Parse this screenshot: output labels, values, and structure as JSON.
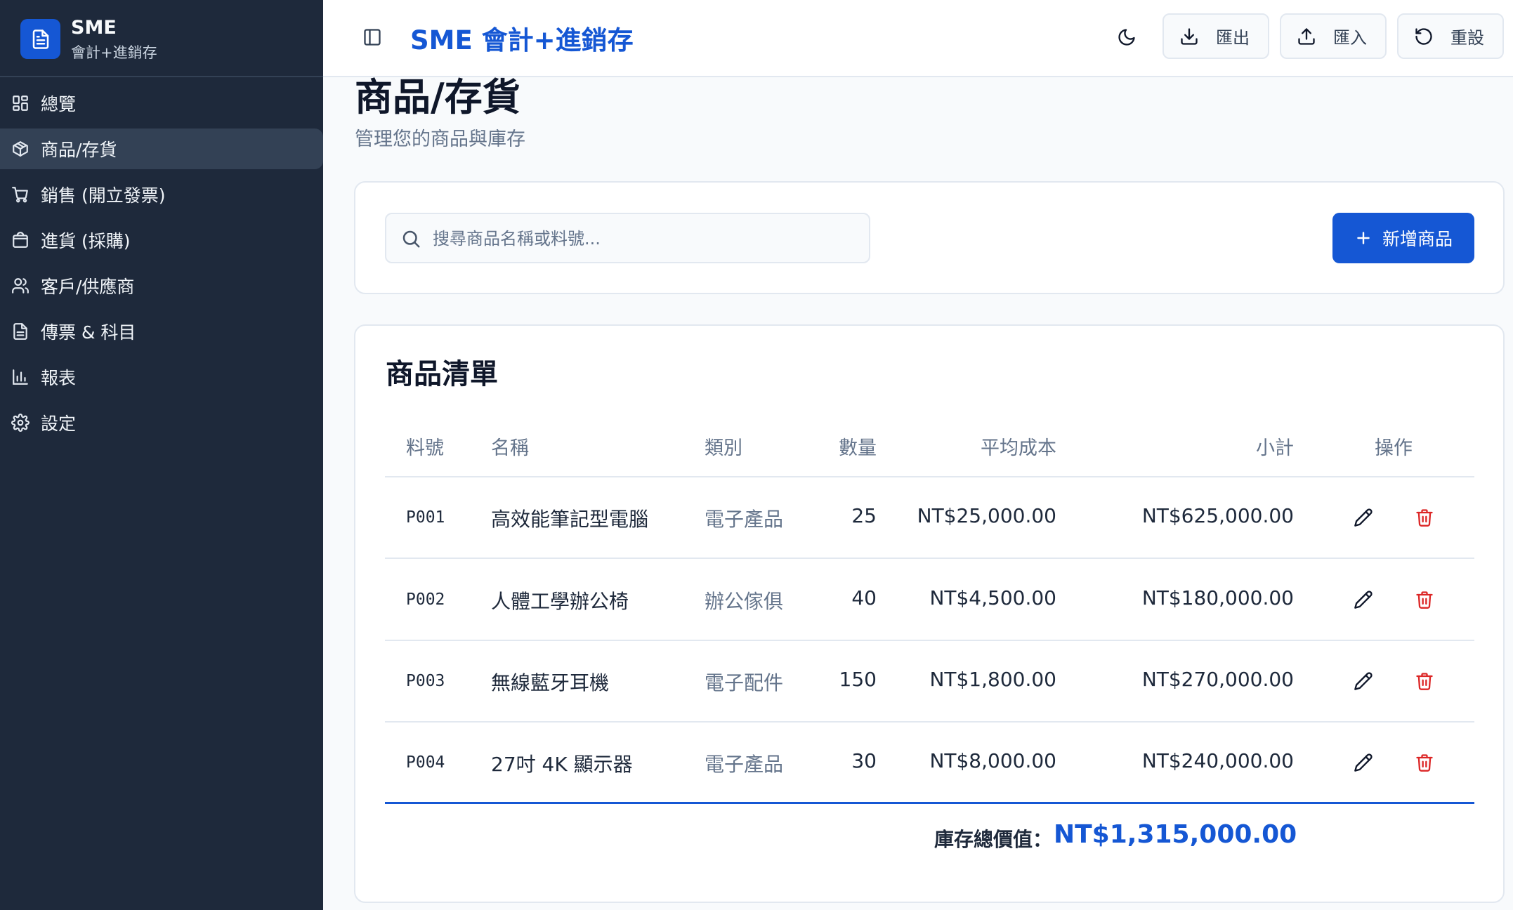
{
  "brand": {
    "title": "SME",
    "subtitle": "會計+進銷存"
  },
  "sidebar": {
    "items": [
      {
        "label": "總覽",
        "icon": "dashboard-icon"
      },
      {
        "label": "商品/存貨",
        "icon": "package-icon",
        "active": true
      },
      {
        "label": "銷售 (開立發票)",
        "icon": "cart-icon"
      },
      {
        "label": "進貨 (採購)",
        "icon": "shopping-bag-icon"
      },
      {
        "label": "客戶/供應商",
        "icon": "users-icon"
      },
      {
        "label": "傳票 & 科目",
        "icon": "file-text-icon"
      },
      {
        "label": "報表",
        "icon": "bar-chart-icon"
      },
      {
        "label": "設定",
        "icon": "gear-icon"
      }
    ]
  },
  "header": {
    "app_title": "SME 會計+進銷存",
    "export_label": "匯出",
    "import_label": "匯入",
    "reset_label": "重設"
  },
  "page": {
    "title": "商品/存貨",
    "subtitle": "管理您的商品與庫存"
  },
  "toolbar": {
    "search_placeholder": "搜尋商品名稱或料號...",
    "add_label": "新增商品"
  },
  "products": {
    "title": "商品清單",
    "columns": {
      "code": "料號",
      "name": "名稱",
      "category": "類別",
      "qty": "數量",
      "cost": "平均成本",
      "subtotal": "小計",
      "actions": "操作"
    },
    "rows": [
      {
        "code": "P001",
        "name": "高效能筆記型電腦",
        "category": "電子產品",
        "qty": "25",
        "cost": "NT$25,000.00",
        "subtotal": "NT$625,000.00"
      },
      {
        "code": "P002",
        "name": "人體工學辦公椅",
        "category": "辦公傢俱",
        "qty": "40",
        "cost": "NT$4,500.00",
        "subtotal": "NT$180,000.00"
      },
      {
        "code": "P003",
        "name": "無線藍牙耳機",
        "category": "電子配件",
        "qty": "150",
        "cost": "NT$1,800.00",
        "subtotal": "NT$270,000.00"
      },
      {
        "code": "P004",
        "name": "27吋 4K 顯示器",
        "category": "電子產品",
        "qty": "30",
        "cost": "NT$8,000.00",
        "subtotal": "NT$240,000.00"
      }
    ],
    "total_label": "庫存總價值：",
    "total_value": "NT$1,315,000.00"
  },
  "colors": {
    "primary": "#1557d4",
    "sidebar_bg": "#1e293b",
    "danger": "#dc2626"
  }
}
